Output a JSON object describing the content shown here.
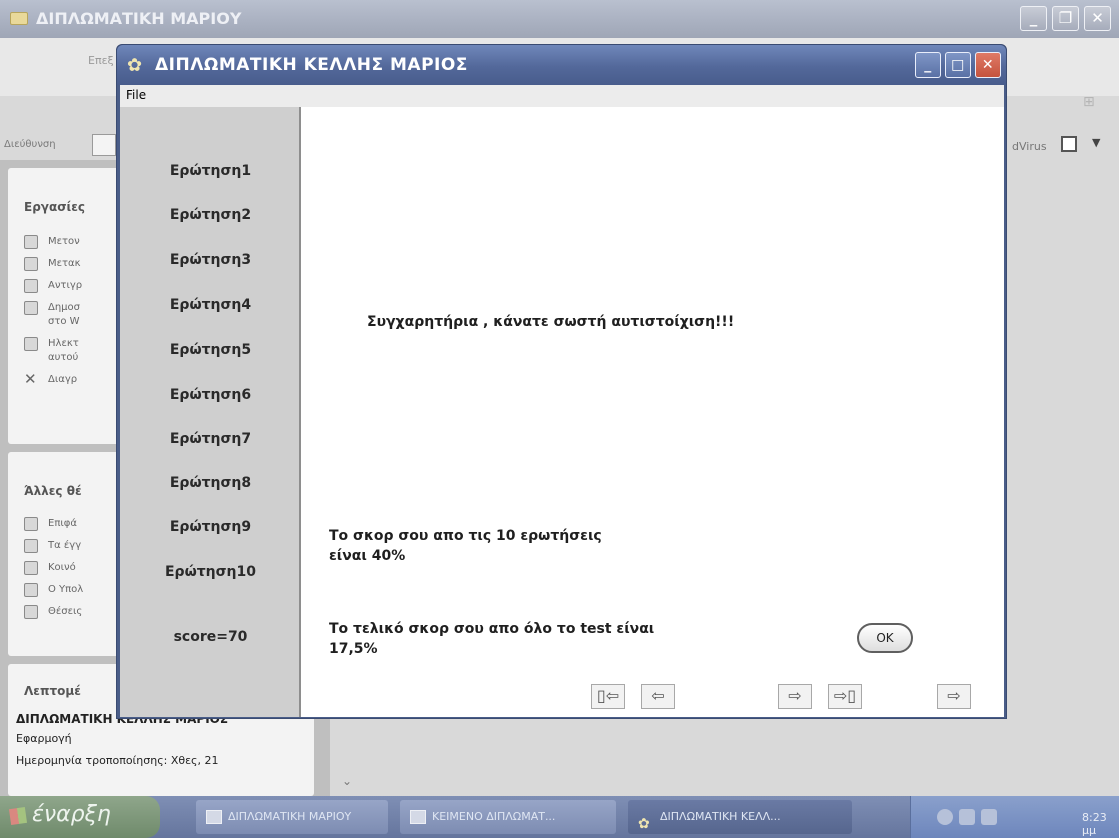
{
  "background_window": {
    "title": "ΔΙΠΛΩΜΑΤΙΚΗ ΜΑΡΙΟΥ",
    "controls": [
      "_",
      "❐",
      "✕"
    ],
    "menu_item": "Επεξ",
    "address_label": "Διεύθυνση",
    "antivirus_label": "dVirus",
    "panels": {
      "tasks": {
        "title": "Εργασίες",
        "items": [
          "Μετον",
          "Μετακ",
          "Αντιγρ",
          "Δημοσ",
          "στο W",
          "Ηλεκτ",
          "αυτού",
          "Διαγρ"
        ]
      },
      "other_places": {
        "title": "Άλλες θέ",
        "items": [
          "Επιφά",
          "Τα έγγ",
          "Κοινό",
          "Ο Υπολ",
          "Θέσεις"
        ]
      },
      "details": {
        "title": "Λεπτομέ",
        "app_name": "ΔΙΠΛΩΜΑΤΙΚΗ ΚΕΛΛΗΣ ΜΑΡΙΟΣ",
        "type": "Εφαρμογή",
        "modified": "Ημερομηνία τροποποίησης: Χθες, 21"
      }
    }
  },
  "dialog": {
    "title": "ΔΙΠΛΩΜΑΤΙΚΗ  ΚΕΛΛΗΣ ΜΑΡΙΟΣ",
    "controls": [
      "_",
      "□",
      "✕"
    ],
    "menu": {
      "file": "File"
    },
    "questions": [
      "Ερώτηση1",
      "Ερώτηση2",
      "Ερώτηση3",
      "Ερώτηση4",
      "Ερώτηση5",
      "Ερώτηση6",
      "Ερώτηση7",
      "Ερώτηση8",
      "Ερώτηση9",
      "Ερώτηση10"
    ],
    "score": "score=70",
    "message": "Συγχαρητήρια , κάνατε σωστή αυτιστοίχιση!!!",
    "score_line1": "Το σκορ σου απο τις 10 ερωτήσεις",
    "score_line2": "είναι 40%",
    "final_line1": "Το τελικό σκορ σου απο όλο το test είναι",
    "final_line2": "17,5%",
    "ok_label": "OK",
    "nav_buttons": {
      "first": "▯⇦",
      "prev": "⇦",
      "next": "⇨",
      "last": "⇨▯",
      "exit": "⇨"
    }
  },
  "taskbar": {
    "start": "έναρξη",
    "tasks": [
      "ΔΙΠΛΩΜΑΤΙΚΗ ΜΑΡΙΟΥ",
      "ΚΕΙΜΕΝΟ ΔΙΠΛΩΜΑΤ...",
      "ΔΙΠΛΩΜΑΤΙΚΗ ΚΕΛΛ..."
    ],
    "clock": "8:23 μμ"
  }
}
